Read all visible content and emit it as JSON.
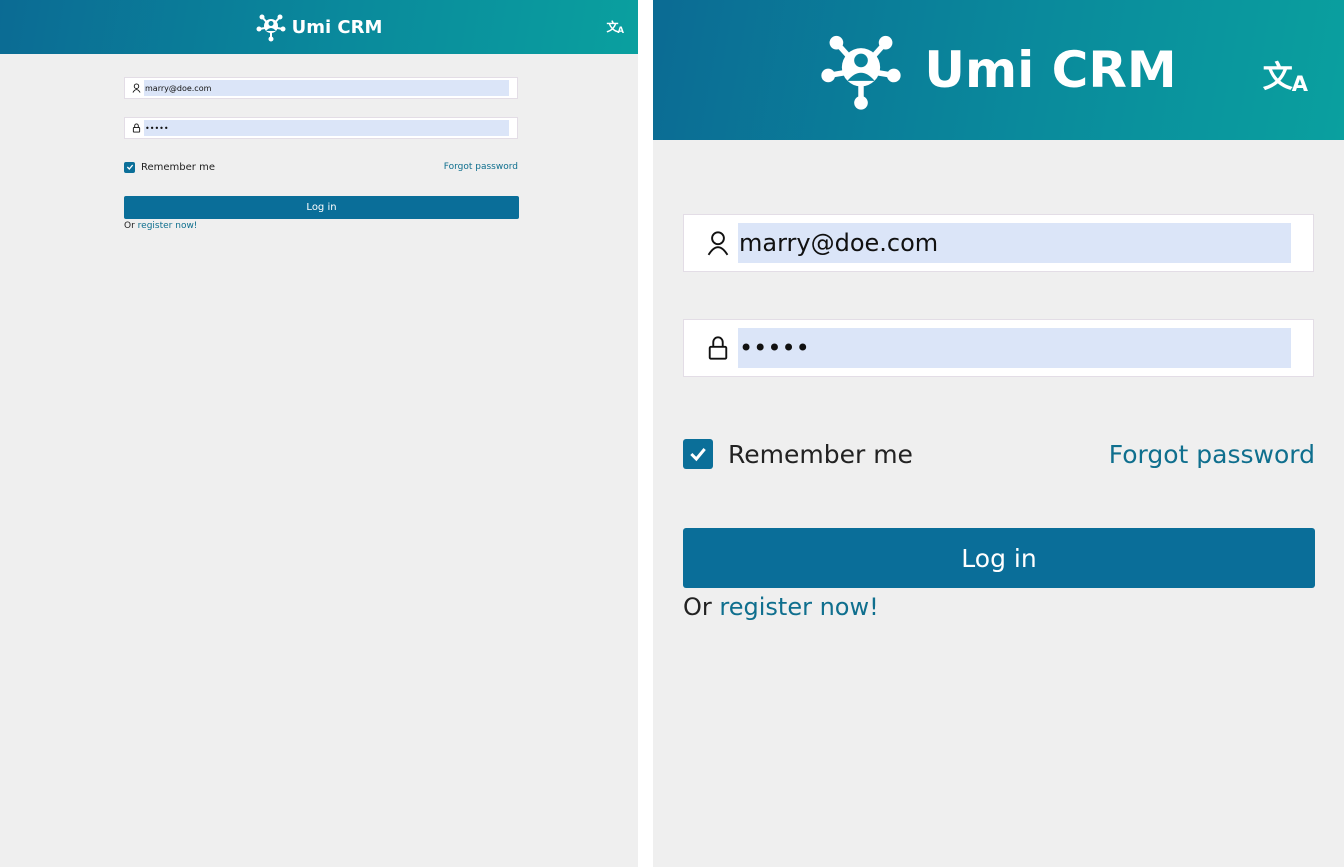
{
  "app": {
    "title": "Umi CRM"
  },
  "header": {
    "language_icon": "translate-icon",
    "logo_icon": "network-user-logo"
  },
  "login_form": {
    "email": {
      "icon": "user-icon",
      "value": "marry@doe.com"
    },
    "password": {
      "icon": "lock-icon",
      "value": "•••••"
    },
    "remember": {
      "label": "Remember me",
      "checked": true
    },
    "forgot_label": "Forgot password",
    "login_label": "Log in",
    "register_prefix": "Or",
    "register_link": "register now!"
  },
  "colors": {
    "header_start": "#0b6b94",
    "header_end": "#0aa09f",
    "primary": "#0a6e99",
    "link": "#0f6f8e",
    "background": "#efefef",
    "autofill": "#dbe5f8"
  }
}
